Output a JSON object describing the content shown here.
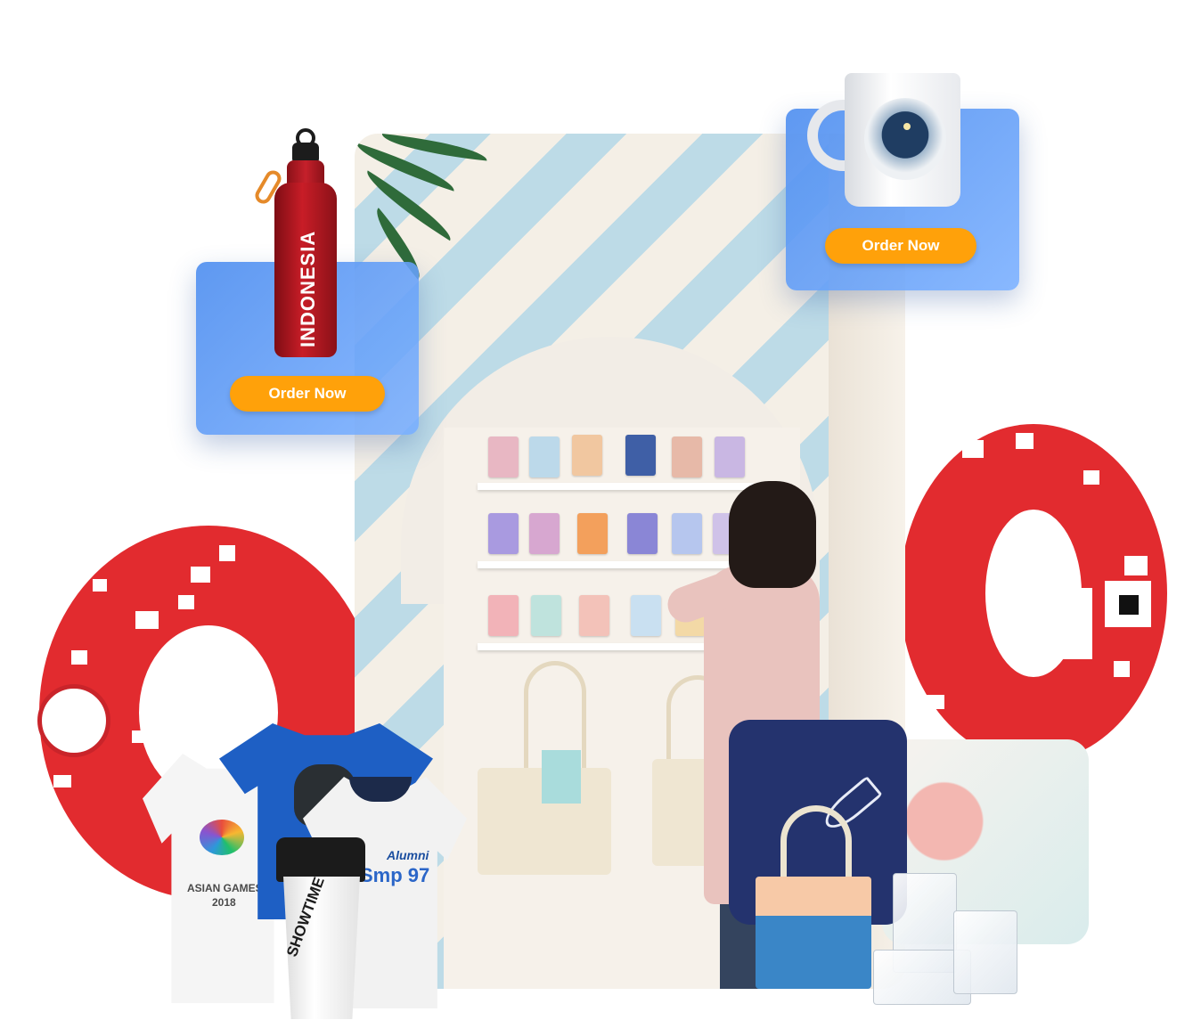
{
  "order_buttons": {
    "bottle_card": "Order Now",
    "mug_card": "Order Now"
  },
  "bottle": {
    "print": "INDONESIA"
  },
  "tshirt": {
    "print": "ASIAN GAMES",
    "year": "2018"
  },
  "polo": {
    "print": "Alumni",
    "sub": "Smp 97"
  },
  "shaker": {
    "print": "SHOWTIME"
  },
  "colors": {
    "order_button": "#ffa10a",
    "product_card": "#5693f0",
    "ring_red": "#e22b2f",
    "shirt_blue": "#1e5fc4"
  }
}
